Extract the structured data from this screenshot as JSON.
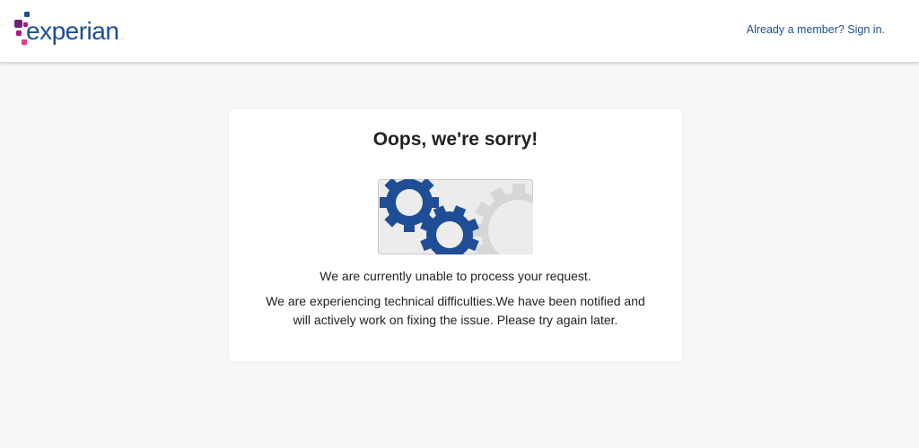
{
  "header": {
    "logo_text": "experian",
    "logo_registered": ".",
    "signin_link": "Already a member? Sign in.",
    "colors": {
      "brand_blue": "#1d4f91",
      "brand_purple": "#6d2077",
      "brand_magenta": "#af1685",
      "brand_pink": "#e63888"
    }
  },
  "error_card": {
    "title": "Oops, we're sorry!",
    "illustration_icon": "gears-icon",
    "message_primary": "We are currently unable to process your request.",
    "message_secondary": "We are experiencing technical difficulties.We have been notified and will actively work on fixing the issue. Please try again later."
  }
}
